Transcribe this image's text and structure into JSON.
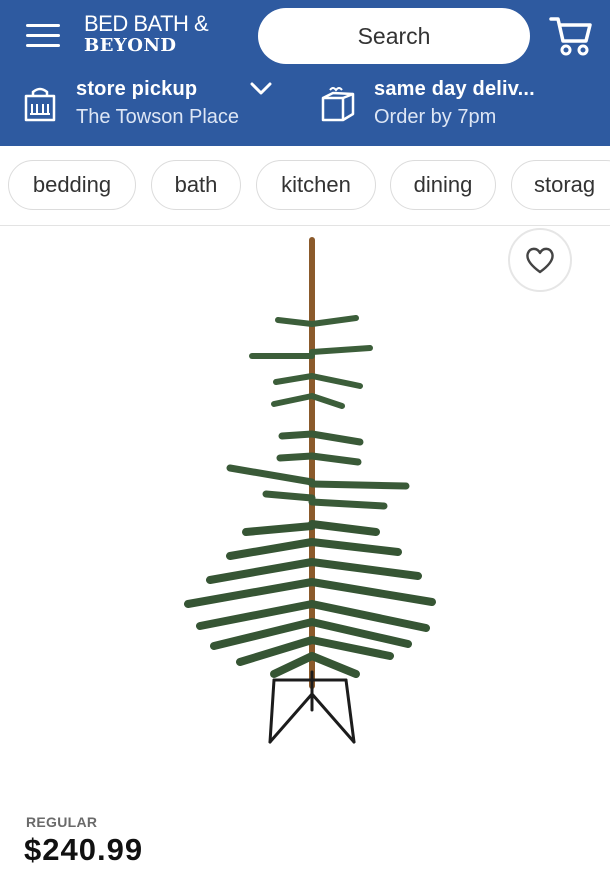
{
  "header": {
    "logo_line1": "BED BATH &",
    "logo_line2": "BEYOND",
    "search_placeholder": "Search",
    "bg_color": "#2e5aa0",
    "icons": [
      "menu-icon",
      "cart-icon",
      "store-bag-icon",
      "chevron-down-icon",
      "delivery-box-icon"
    ],
    "pickup": {
      "title": "store pickup",
      "subtitle": "The Towson Place"
    },
    "delivery": {
      "title": "same day deliv...",
      "subtitle": "Order by 7pm"
    }
  },
  "categories": [
    "bedding",
    "bath",
    "kitchen",
    "dining",
    "storag"
  ],
  "product": {
    "price_label": "REGULAR",
    "price": "$240.99",
    "favorite_icon": "heart-icon"
  }
}
